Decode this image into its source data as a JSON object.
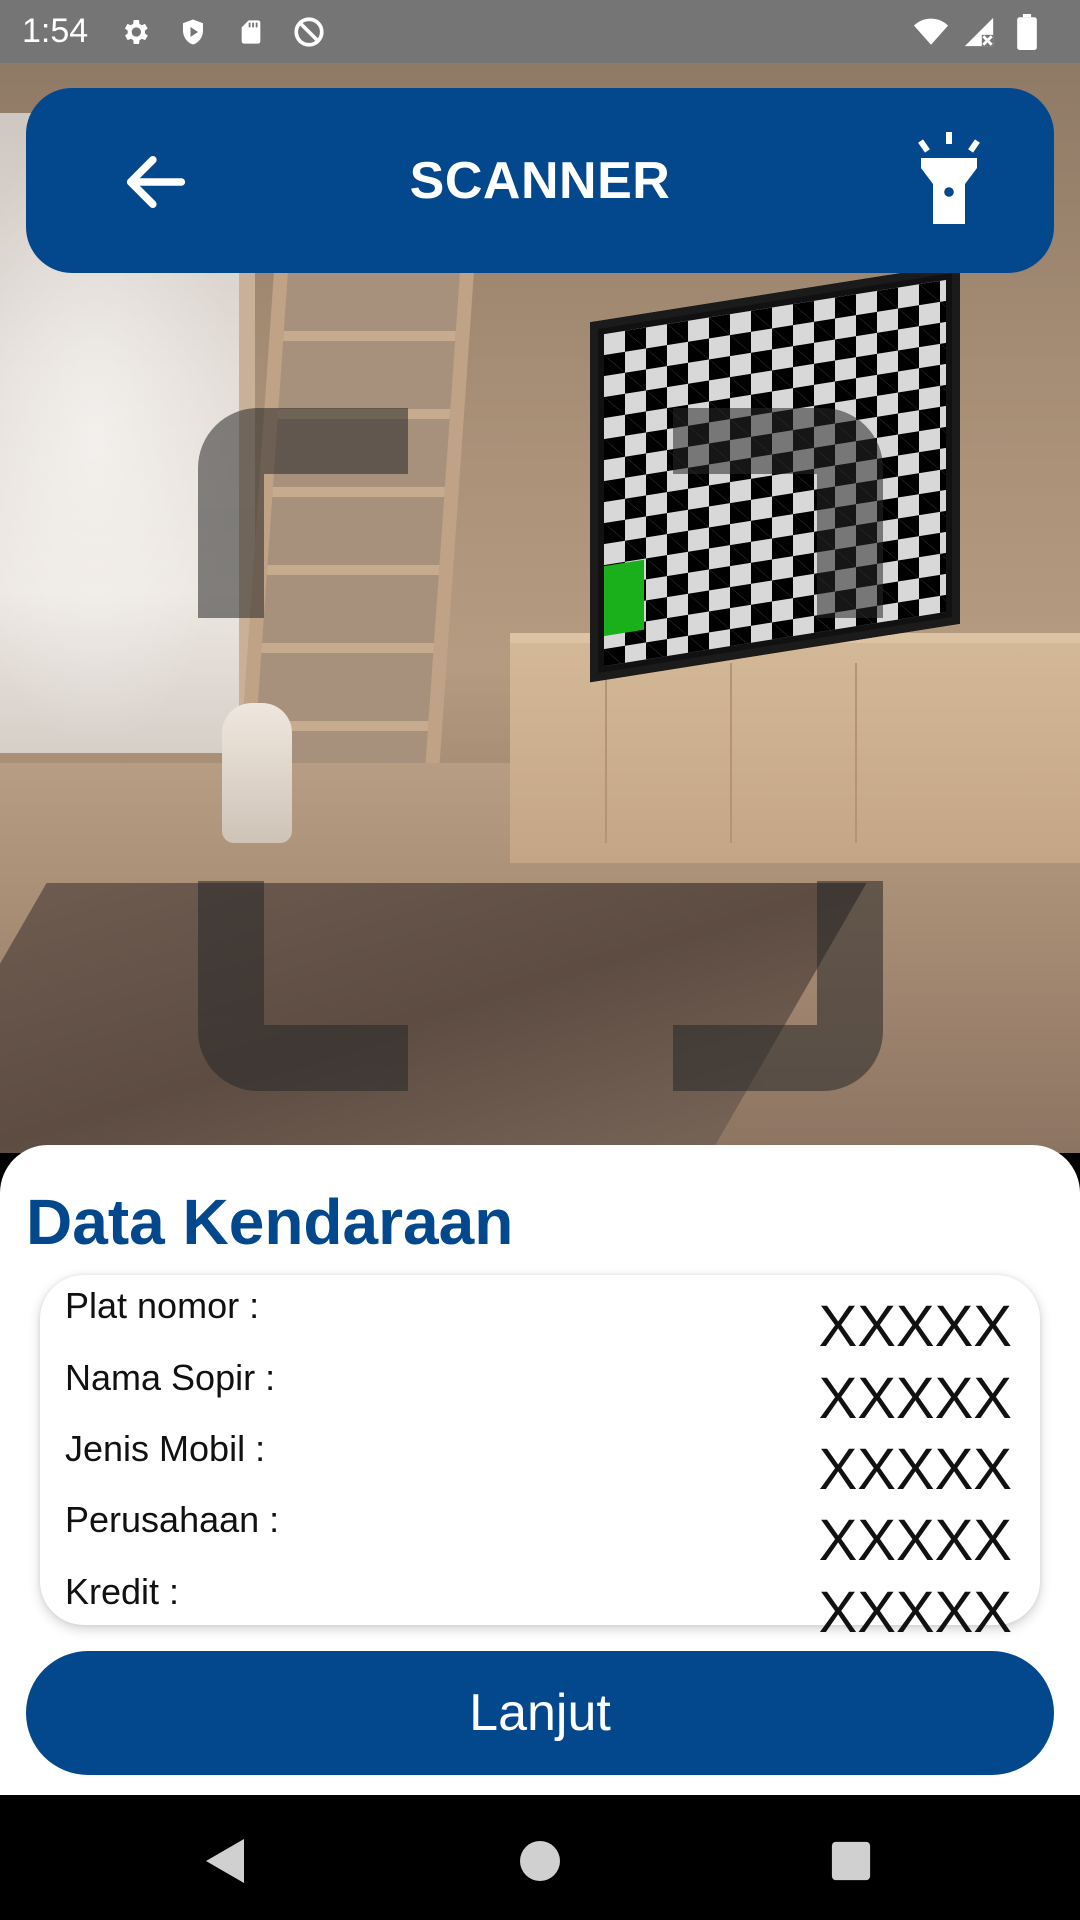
{
  "status_bar": {
    "time": "1:54",
    "left_icons": [
      "settings-icon",
      "shield-icon",
      "sd-card-icon",
      "at-icon"
    ],
    "right_icons": [
      "wifi-icon",
      "signal-icon",
      "battery-icon"
    ]
  },
  "header": {
    "title": "SCANNER",
    "back_icon": "back-arrow-icon",
    "torch_icon": "flashlight-icon",
    "background_color": "#03478c"
  },
  "sheet": {
    "title": "Data Kendaraan",
    "fields": [
      {
        "label": "Plat nomor :",
        "value": "XXXXX"
      },
      {
        "label": "Nama Sopir :",
        "value": "XXXXX"
      },
      {
        "label": "Jenis Mobil :",
        "value": "XXXXX"
      },
      {
        "label": "Perusahaan :",
        "value": "XXXXX"
      },
      {
        "label": "Kredit :",
        "value": "XXXXX"
      }
    ],
    "button_label": "Lanjut",
    "accent_color": "#03478c"
  },
  "nav_bar": {
    "buttons": [
      "nav-back-icon",
      "nav-home-icon",
      "nav-recents-icon"
    ]
  }
}
